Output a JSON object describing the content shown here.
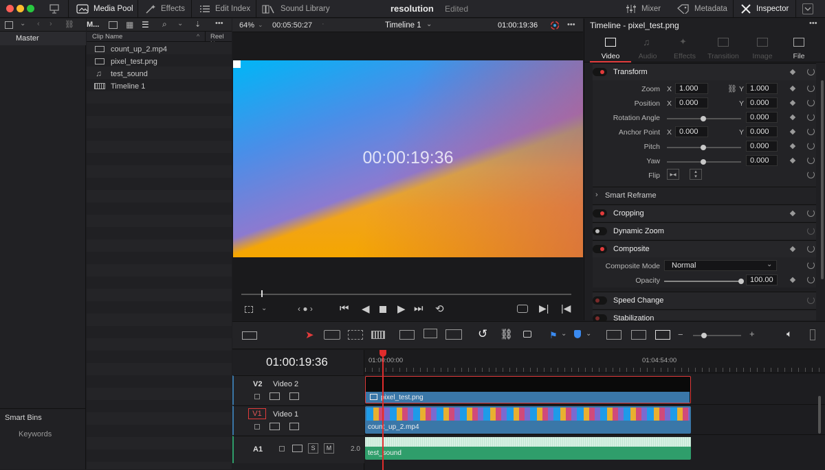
{
  "app": {
    "project_name": "resolution",
    "project_status": "Edited"
  },
  "topbar": {
    "media_pool": "Media Pool",
    "effects": "Effects",
    "edit_index": "Edit Index",
    "sound_library": "Sound Library",
    "mixer": "Mixer",
    "metadata": "Metadata",
    "inspector": "Inspector"
  },
  "colors": {
    "accent_red": "#e23b3b",
    "video_clip": "#3a77a8",
    "audio_clip": "#2f9e6b",
    "playhead": "#e02c2c"
  },
  "bins": {
    "master": "Master",
    "smart_bins": "Smart Bins",
    "keywords": "Keywords",
    "panel_title": "M..."
  },
  "pool": {
    "col_clip_name": "Clip Name",
    "col_reel_name": "Reel Na",
    "clips": [
      {
        "name": "count_up_2.mp4",
        "icon": "video-clip-icon"
      },
      {
        "name": "pixel_test.png",
        "icon": "image-clip-icon"
      },
      {
        "name": "test_sound",
        "icon": "music-note-icon"
      },
      {
        "name": "Timeline 1",
        "icon": "timeline-icon"
      }
    ]
  },
  "viewer": {
    "zoom": "64%",
    "duration": "00:05:50:27",
    "timeline_name": "Timeline 1",
    "timecode": "01:00:19:36",
    "overlay_timecode": "00:00:19:36"
  },
  "inspector": {
    "title": "Timeline - pixel_test.png",
    "tabs": [
      "Video",
      "Audio",
      "Effects",
      "Transition",
      "Image",
      "File"
    ],
    "active_tab": "Video",
    "transform": {
      "label": "Transform",
      "zoom_label": "Zoom",
      "zoom_x": "1.000",
      "zoom_y": "1.000",
      "position_label": "Position",
      "position_x": "0.000",
      "position_y": "0.000",
      "rotation_label": "Rotation Angle",
      "rotation": "0.000",
      "anchor_label": "Anchor Point",
      "anchor_x": "0.000",
      "anchor_y": "0.000",
      "pitch_label": "Pitch",
      "pitch": "0.000",
      "yaw_label": "Yaw",
      "yaw": "0.000",
      "flip_label": "Flip",
      "x": "X",
      "y": "Y"
    },
    "smart_reframe": "Smart Reframe",
    "cropping": "Cropping",
    "dynamic_zoom": "Dynamic Zoom",
    "composite": {
      "label": "Composite",
      "mode_label": "Composite Mode",
      "mode": "Normal",
      "opacity_label": "Opacity",
      "opacity": "100.00"
    },
    "speed_change": "Speed Change",
    "stabilization": "Stabilization"
  },
  "timeline": {
    "timecode": "01:00:19:36",
    "ruler": [
      "01:00:00:00",
      "01:04:54:00"
    ],
    "tracks": [
      {
        "id": "V2",
        "name": "Video 2",
        "clip": "pixel_test.png"
      },
      {
        "id": "V1",
        "name": "Video 1",
        "clip": "count_up_2.mp4"
      },
      {
        "id": "A1",
        "name": "",
        "level": "2.0",
        "clip": "test_sound"
      }
    ],
    "audio_buttons": {
      "solo": "S",
      "mute": "M"
    }
  }
}
